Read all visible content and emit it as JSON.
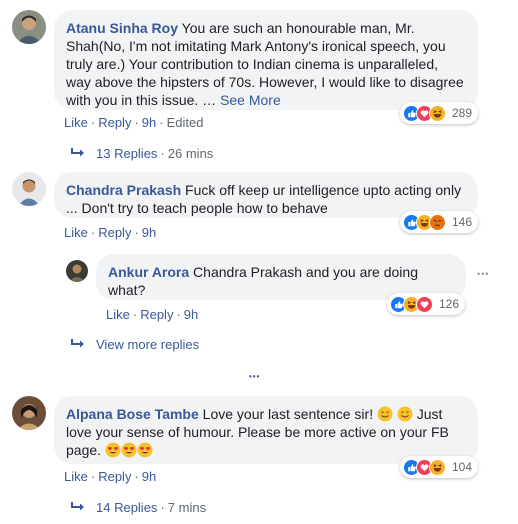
{
  "colors": {
    "link": "#385898",
    "bubble": "#f2f3f5",
    "meta": "#606770",
    "like": "#1877f2",
    "love": "#f33e58",
    "haha": "#f7b125"
  },
  "comments": [
    {
      "author": "Atanu Sinha Roy",
      "text": " You are such an honourable man, Mr. Shah(No, I'm not imitating Mark Antony's ironical speech, you truly are.) Your contribution to Indian cinema is unparalleled, way above the hipsters of 70s. However, I would like to disagree with you in this issue. … ",
      "see_more": "See More",
      "like": "Like",
      "reply": "Reply",
      "time": "9h",
      "edited": "Edited",
      "reactions": [
        "like-icon",
        "love-icon",
        "haha-icon"
      ],
      "reaction_count": "289",
      "replies_label": "13 Replies",
      "replies_time": "26 mins"
    },
    {
      "author": "Chandra Prakash",
      "text": " Fuck off keep ur intelligence upto acting only ... Don't try to teach people how to behave",
      "like": "Like",
      "reply": "Reply",
      "time": "9h",
      "reactions": [
        "like-icon",
        "haha-icon",
        "angry-icon"
      ],
      "reaction_count": "146"
    },
    {
      "author": "Alpana Bose Tambe",
      "text_1": " Love your last sentence sir! ",
      "text_2": " Just love your sense of humour. Please be more active on your FB page. ",
      "like": "Like",
      "reply": "Reply",
      "time": "9h",
      "reactions": [
        "like-icon",
        "love-icon",
        "haha-icon"
      ],
      "reaction_count": "104",
      "replies_label": "14 Replies",
      "replies_time": "7 mins"
    }
  ],
  "nested_reply": {
    "author": "Ankur Arora",
    "text": " Chandra Prakash and you are doing what?",
    "like": "Like",
    "reply": "Reply",
    "time": "9h",
    "reactions": [
      "like-icon",
      "haha-icon",
      "love-icon"
    ],
    "reaction_count": "126",
    "view_more": "View more replies"
  },
  "separators": {
    "dot": "·",
    "more": "•••"
  }
}
